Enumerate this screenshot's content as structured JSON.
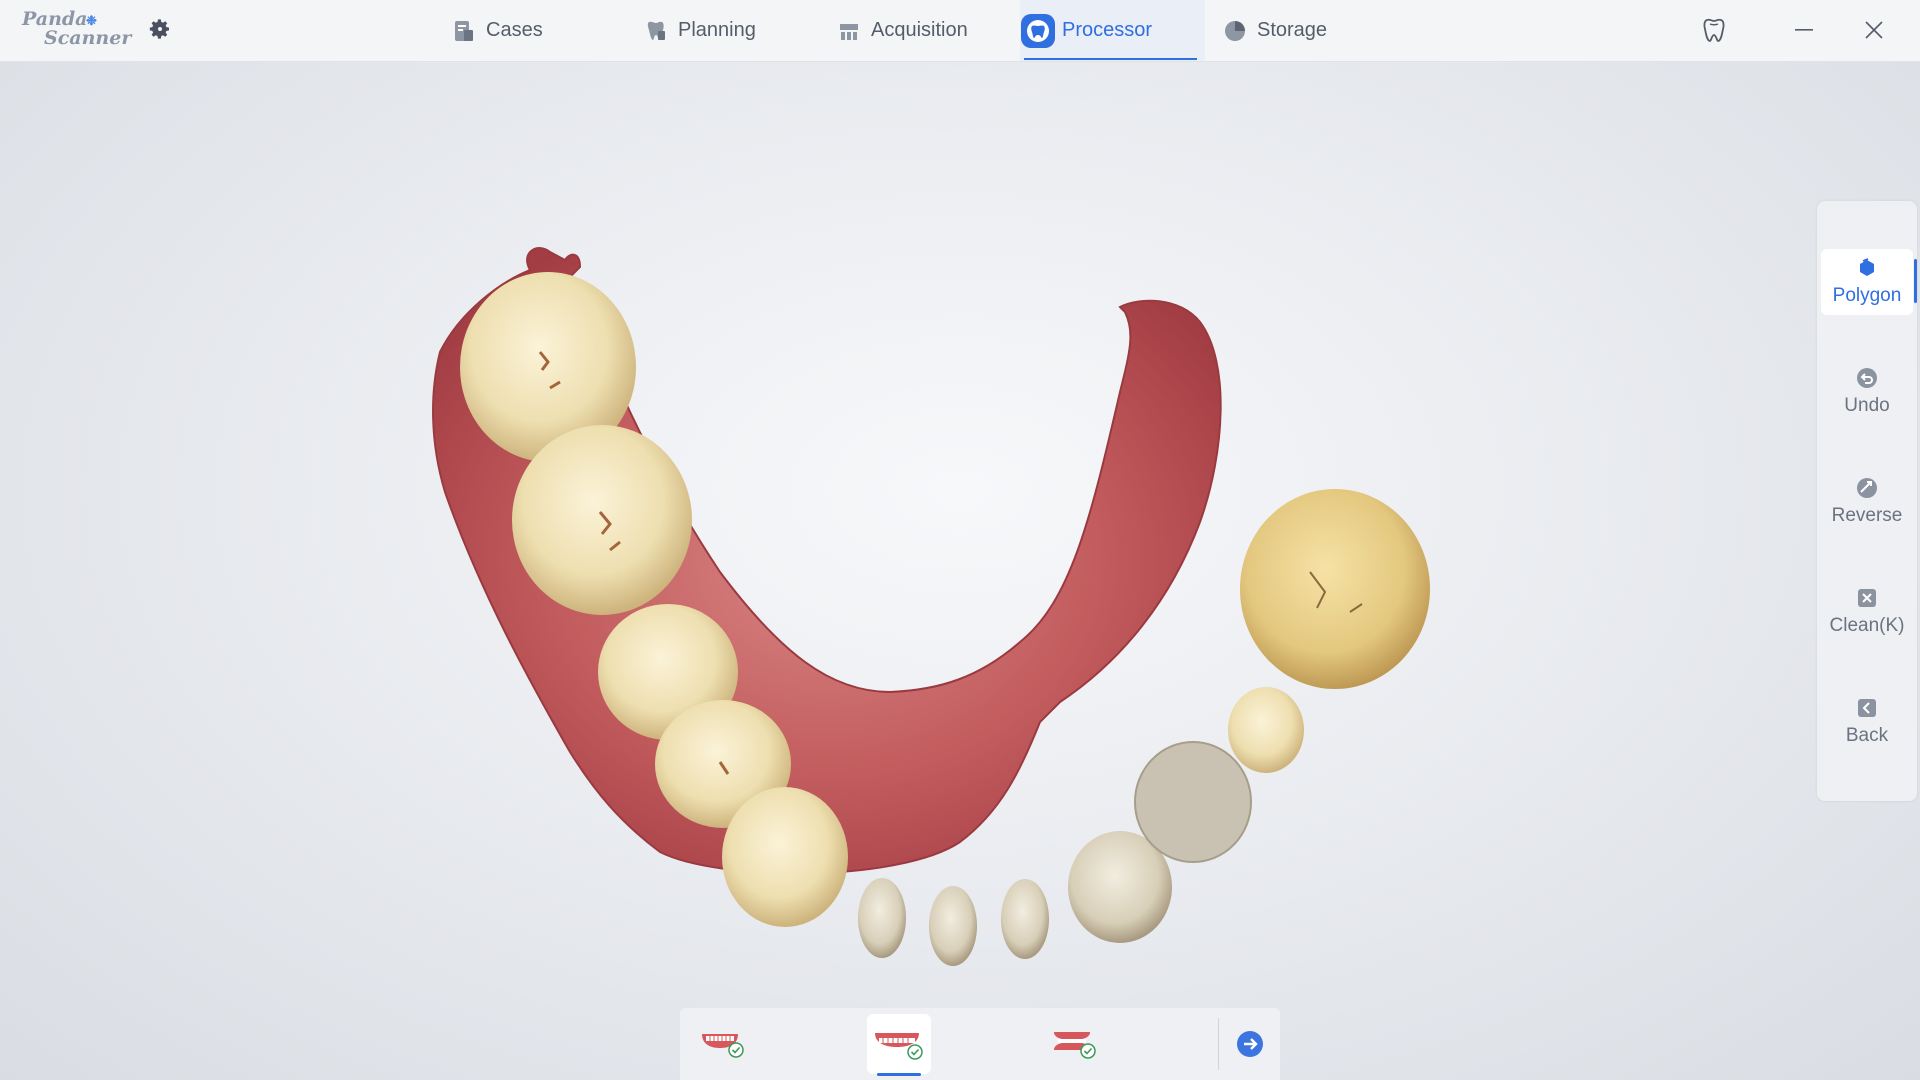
{
  "app": {
    "logo_line1": "Panda",
    "logo_line2": "Scanner",
    "accent": "#2f6fe0"
  },
  "nav": {
    "tabs": [
      {
        "label": "Cases",
        "icon": "cases-icon"
      },
      {
        "label": "Planning",
        "icon": "planning-icon"
      },
      {
        "label": "Acquisition",
        "icon": "acquisition-icon"
      },
      {
        "label": "Processor",
        "icon": "processor-icon",
        "active": true
      },
      {
        "label": "Storage",
        "icon": "storage-icon"
      }
    ]
  },
  "window": {
    "icons": [
      "tooth-icon",
      "minimize-icon",
      "close-icon"
    ]
  },
  "tools": [
    {
      "label": "Polygon",
      "icon": "polygon-icon",
      "active": true
    },
    {
      "label": "Undo",
      "icon": "undo-icon"
    },
    {
      "label": "Reverse",
      "icon": "reverse-icon"
    },
    {
      "label": "Clean(K)",
      "icon": "clean-icon"
    },
    {
      "label": "Back",
      "icon": "back-icon"
    }
  ],
  "jaw_selector": {
    "items": [
      {
        "icon": "upper-jaw-icon",
        "checked": true
      },
      {
        "icon": "lower-jaw-icon",
        "checked": true,
        "active": true
      },
      {
        "icon": "bite-jaw-icon",
        "checked": true
      }
    ],
    "next_icon": "next-arrow-icon"
  },
  "colors": {
    "gum": "#b8494d",
    "tooth": "#efe0b4"
  }
}
